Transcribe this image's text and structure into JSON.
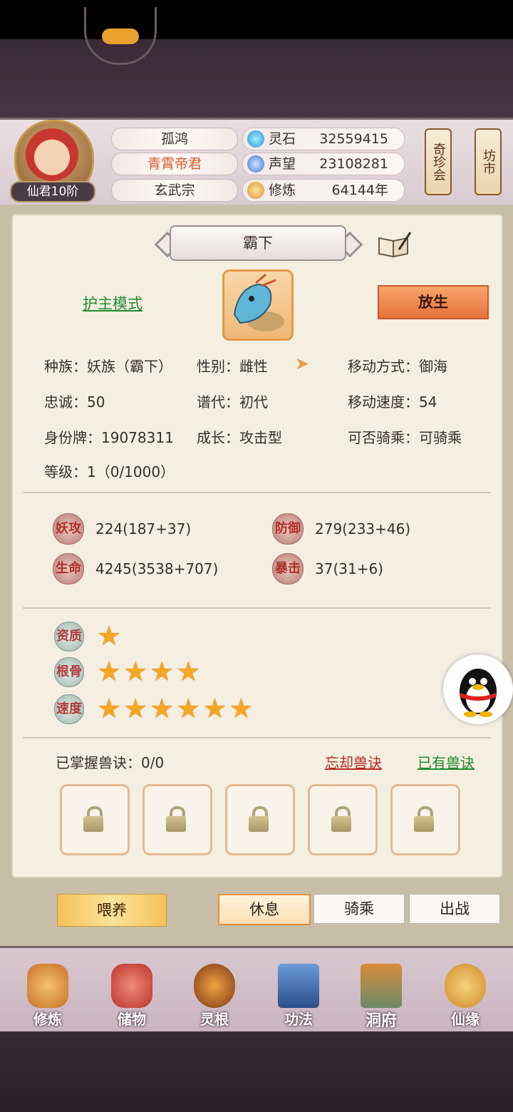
{
  "header": {
    "rank": "仙君10阶",
    "player_name": "孤鸿",
    "title": "青霄帝君",
    "sect": "玄武宗",
    "resources": [
      {
        "label": "灵石",
        "value": "32559415",
        "icon": "spirit-stone-icon"
      },
      {
        "label": "声望",
        "value": "23108281",
        "icon": "prestige-icon"
      },
      {
        "label": "修炼",
        "value": "64144年",
        "icon": "cultivate-icon"
      }
    ],
    "shop_buttons": [
      "奇珍会",
      "坊市"
    ]
  },
  "pet": {
    "name": "霸下",
    "protect_mode": "护主模式",
    "release": "放生",
    "info": {
      "race": "种族：妖族（霸下）",
      "gender": "性别：雌性",
      "move_type": "移动方式：御海",
      "loyalty": "忠诚：50",
      "generation": "谱代：初代",
      "move_speed": "移动速度：54",
      "id_tag": "身份牌：19078311",
      "growth": "成长：攻击型",
      "rideable": "可否骑乘：可骑乘",
      "level": "等级：1（0/1000）"
    },
    "stats": [
      {
        "label": "妖攻",
        "value": "224(187+37)"
      },
      {
        "label": "防御",
        "value": "279(233+46)"
      },
      {
        "label": "生命",
        "value": "4245(3538+707)"
      },
      {
        "label": "暴击",
        "value": "37(31+6)"
      }
    ],
    "qualities": [
      {
        "label": "资质",
        "stars": 1
      },
      {
        "label": "根骨",
        "stars": 4
      },
      {
        "label": "速度",
        "stars": 6
      }
    ],
    "skills": {
      "mastered": "已掌握兽诀：0/0",
      "forget": "忘却兽诀",
      "owned": "已有兽诀",
      "slots": 5
    }
  },
  "actions": {
    "feed": "喂养",
    "modes": [
      "休息",
      "骑乘",
      "出战"
    ],
    "active_mode": "休息"
  },
  "nav": [
    "修炼",
    "储物",
    "灵根",
    "功法",
    "洞府",
    "仙缘"
  ],
  "colors": {
    "accent": "#e8733c",
    "green_link": "#1f8a2e",
    "red_link": "#b52a22"
  }
}
